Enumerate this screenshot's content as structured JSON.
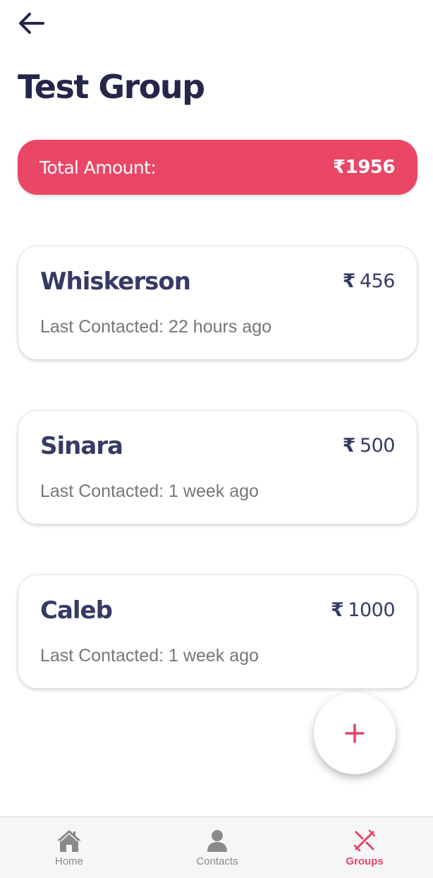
{
  "header": {
    "back_icon": "arrow-left-icon",
    "title": "Test Group"
  },
  "total": {
    "label": "Total Amount:",
    "value": "₹1956"
  },
  "members": [
    {
      "name": "Whiskerson",
      "currency": "₹",
      "amount": "456",
      "last_contacted": "Last Contacted: 22 hours ago"
    },
    {
      "name": "Sinara",
      "currency": "₹",
      "amount": "500",
      "last_contacted": "Last Contacted: 1 week ago"
    },
    {
      "name": "Caleb",
      "currency": "₹",
      "amount": "1000",
      "last_contacted": "Last Contacted: 1 week ago"
    }
  ],
  "fab": {
    "icon": "plus-icon"
  },
  "tabbar": {
    "tabs": [
      {
        "label": "Home",
        "icon": "home-icon",
        "active": false
      },
      {
        "label": "Contacts",
        "icon": "person-icon",
        "active": false
      },
      {
        "label": "Groups",
        "icon": "groups-icon",
        "active": true
      }
    ]
  },
  "colors": {
    "accent": "#ea4666",
    "title": "#24274a",
    "card_text": "#353b65",
    "muted": "#767676",
    "tab_inactive": "#8a8a8a",
    "tab_active": "#e2456a"
  }
}
